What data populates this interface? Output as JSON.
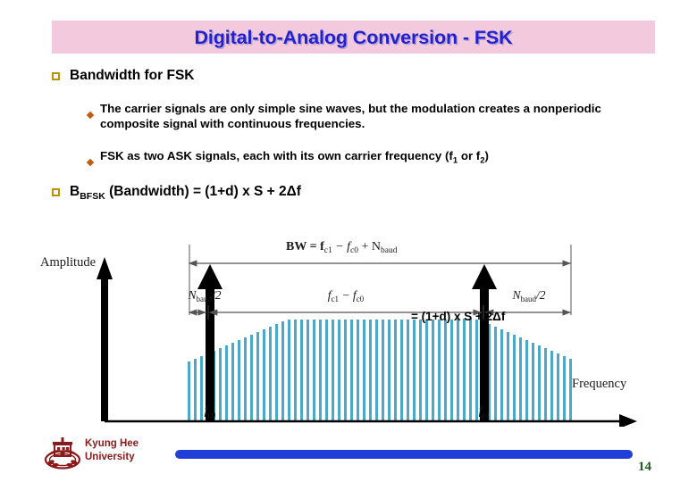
{
  "slide": {
    "title": "Digital-to-Analog Conversion - FSK",
    "title_color": "#2222cc",
    "title_band_color": "#f2c9dd",
    "page_number": "14"
  },
  "bullets": {
    "level1": [
      {
        "marker": "hollow-square",
        "text": "Bandwidth for FSK"
      }
    ],
    "level2": [
      {
        "marker": "diamond",
        "text": "The carrier signals are only simple sine waves, but the modulation creates a nonperiodic composite signal with continuous frequencies."
      },
      {
        "marker": "diamond",
        "text_parts": {
          "a": "FSK as two ASK signals, each with its own carrier frequency (f",
          "sub1": "1",
          "b": " or f",
          "sub2": "2",
          "c": ")"
        }
      }
    ],
    "formula_line": {
      "marker": "hollow-square",
      "lead": "B",
      "sub": "BFSK",
      "rest": " (Bandwidth) = (1+d) x S + 2Δf"
    }
  },
  "diagram": {
    "caption_top": "BW = f",
    "caption_top_sub1": "c1",
    "caption_top_mid": " −  f",
    "caption_top_sub2": "c0",
    "caption_top_end": " + N",
    "caption_top_sub3": "baud",
    "axis_y_label": "Amplitude",
    "axis_x_label": "Frequency",
    "seg_left_label": "N",
    "seg_left_sub": "baud",
    "seg_left_tail": "/2",
    "seg_mid_label": "f",
    "seg_mid_sub1": "c1",
    "seg_mid_dash": " − f",
    "seg_mid_sub2": "c0",
    "seg_right_label": "N",
    "seg_right_sub": "baud",
    "seg_right_tail": "/2",
    "carrier_low_label": "f",
    "carrier_low_sub": "c0",
    "carrier_high_label": "f",
    "carrier_high_sub": "c1",
    "overlay_formula": "= (1+d) x S + 2Δf",
    "spectrum_color": "#4aa8c8",
    "line_color": "#555555"
  },
  "footer": {
    "university_line1": "Kyung Hee",
    "university_line2": "University",
    "logo_color": "#8b1a1a",
    "bar_color": "#1f3fd8",
    "page_number_color": "#1f5c1f"
  }
}
